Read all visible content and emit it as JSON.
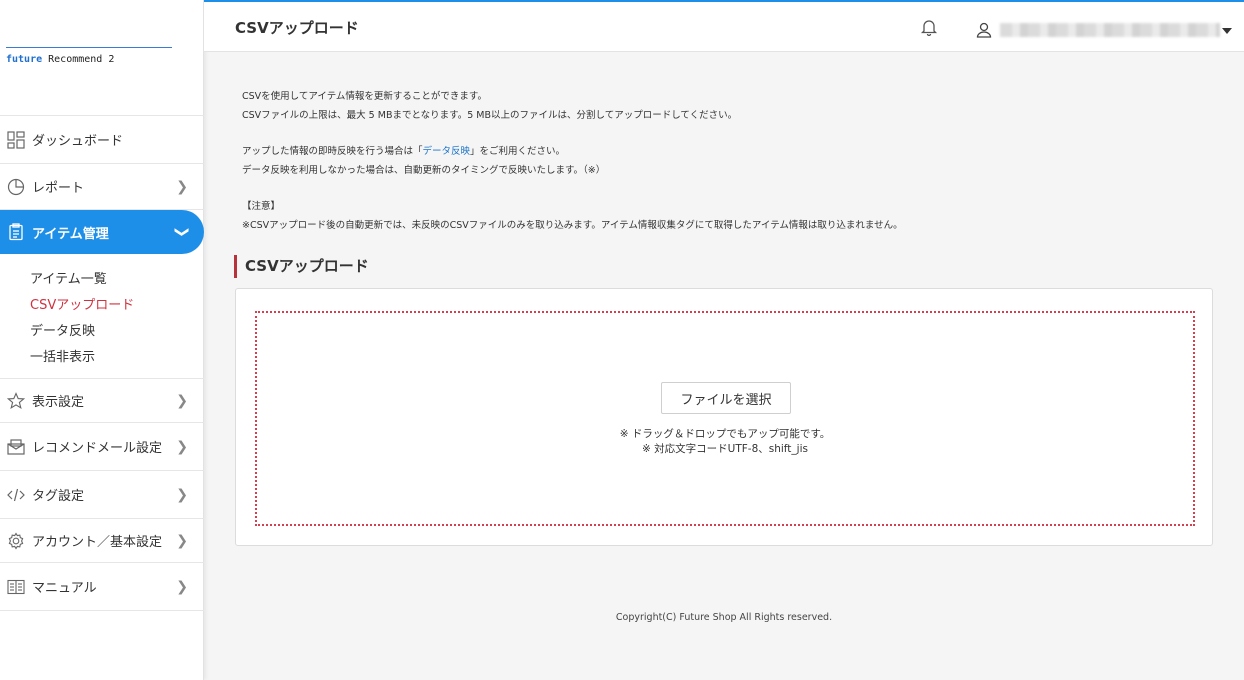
{
  "logo": {
    "brand": "future",
    "product": " Recommend 2"
  },
  "sidebar": {
    "items": [
      {
        "label": "ダッシュボード",
        "icon": "dashboard-icon"
      },
      {
        "label": "レポート",
        "icon": "pie-chart-icon"
      },
      {
        "label": "アイテム管理",
        "icon": "clipboard-icon",
        "active": true
      },
      {
        "label": "表示設定",
        "icon": "star-icon"
      },
      {
        "label": "レコメンドメール設定",
        "icon": "mail-icon"
      },
      {
        "label": "タグ設定",
        "icon": "code-icon"
      },
      {
        "label": "アカウント／基本設定",
        "icon": "gear-icon"
      },
      {
        "label": "マニュアル",
        "icon": "book-icon"
      }
    ],
    "subitems": [
      {
        "label": "アイテム一覧"
      },
      {
        "label": "CSVアップロード",
        "current": true
      },
      {
        "label": "データ反映"
      },
      {
        "label": "一括非表示"
      }
    ]
  },
  "header": {
    "title": "CSVアップロード",
    "bell_icon": "bell-icon",
    "user_icon": "user-icon"
  },
  "intro": {
    "line1": "CSVを使用してアイテム情報を更新することができます。",
    "line2": "CSVファイルの上限は、最大 5 MBまでとなります。5 MB以上のファイルは、分割してアップロードしてください。",
    "line3_pre": "アップした情報の即時反映を行う場合は「",
    "line3_link": "データ反映",
    "line3_post": "」をご利用ください。",
    "line4": "データ反映を利用しなかった場合は、自動更新のタイミングで反映いたします。（※）",
    "line5": "【注意】",
    "line6": "※CSVアップロード後の自動更新では、未反映のCSVファイルのみを取り込みます。アイテム情報収集タグにて取得したアイテム情報は取り込まれません。"
  },
  "upload": {
    "section_title": "CSVアップロード",
    "button_label": "ファイルを選択",
    "note1": "※ ドラッグ＆ドロップでもアップ可能です。",
    "note2": "※ 対応文字コードUTF-8、shift_jis"
  },
  "footer": {
    "copyright": "Copyright(C) Future Shop All Rights reserved."
  },
  "colors": {
    "accent": "#1e8fe8",
    "current": "#d0313e",
    "section_bar": "#b8323c",
    "dropzone": "#d44050",
    "link": "#1a73c9"
  }
}
